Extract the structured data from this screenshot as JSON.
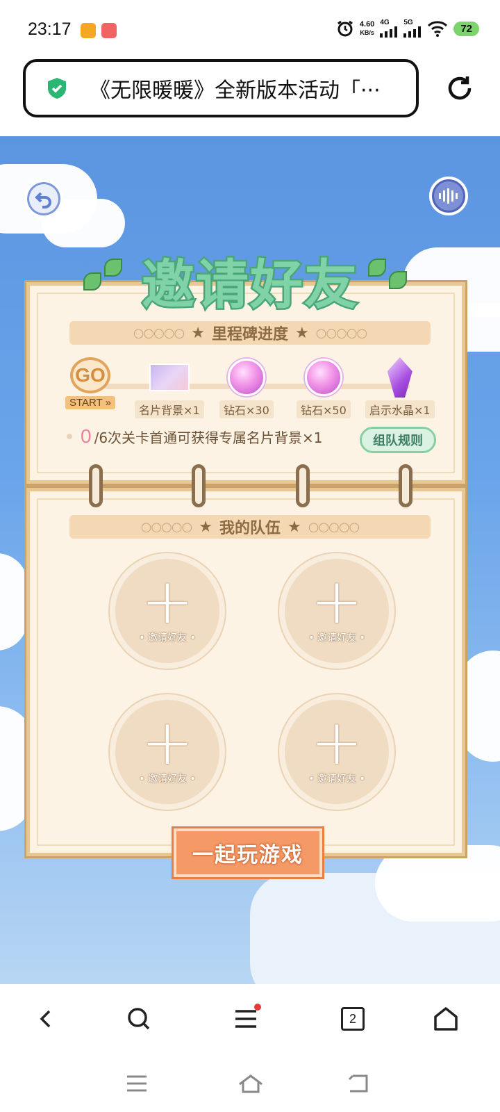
{
  "status_bar": {
    "time": "23:17",
    "net_speed_value": "4.60",
    "net_speed_unit": "KB/s",
    "signal_1": "4G",
    "signal_2": "5G",
    "battery": "72"
  },
  "address_bar": {
    "url_text": "《无限暖暖》全新版本活动「···",
    "secure_icon": "shield-check-icon",
    "refresh_icon": "refresh-icon"
  },
  "game": {
    "title": "邀请好友",
    "milestone_banner": "里程碑进度",
    "milestones": [
      {
        "label": "START »",
        "icon": "go-icon",
        "icon_text": "GO"
      },
      {
        "label": "名片背景×1",
        "icon": "card-background-icon"
      },
      {
        "label": "钻石×30",
        "icon": "diamond-icon"
      },
      {
        "label": "钻石×50",
        "icon": "diamond-icon"
      },
      {
        "label": "启示水晶×1",
        "icon": "crystal-icon"
      }
    ],
    "progress_count": "0",
    "progress_text": "/6次关卡首通可获得专属名片背景×1",
    "rules_button": "组队规则",
    "team_banner": "我的队伍",
    "slots": [
      {
        "label": "• 邀请好友 •"
      },
      {
        "label": "• 邀请好友 •"
      },
      {
        "label": "• 邀请好友 •"
      },
      {
        "label": "• 邀请好友 •"
      }
    ],
    "play_button": "一起玩游戏"
  },
  "bottom_nav": {
    "tab_count": "2"
  },
  "colors": {
    "sky": "#6aa4ea",
    "title_green": "#7fd3a7",
    "panel": "#fcf3e5",
    "play_orange": "#f59a67",
    "progress_pink": "#f27fa0"
  }
}
